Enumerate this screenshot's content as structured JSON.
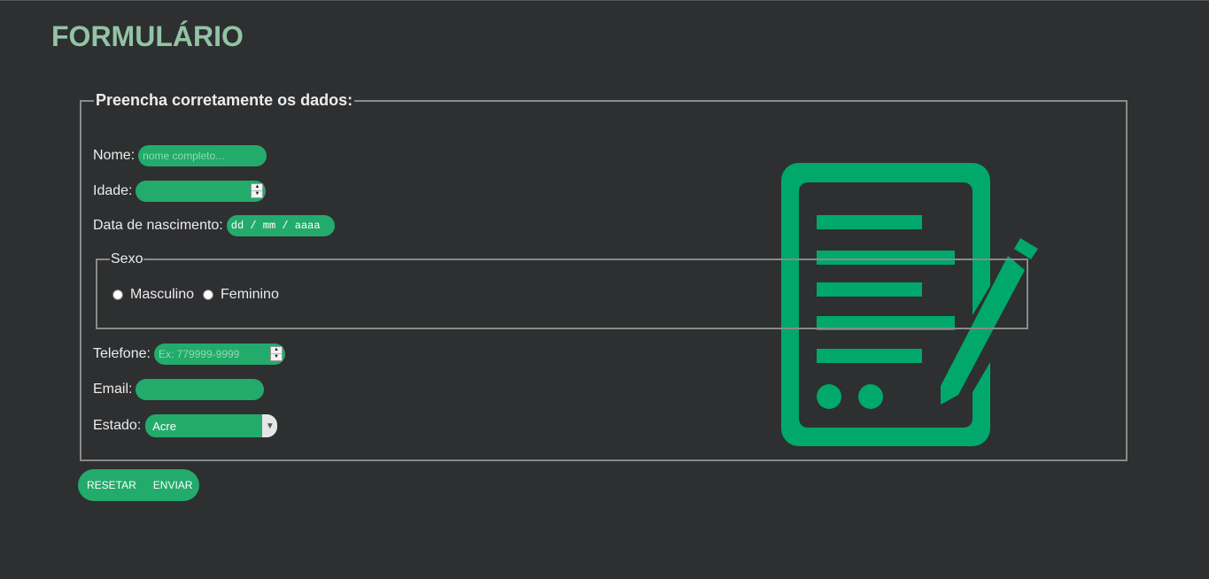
{
  "page": {
    "title": "FORMULÁRIO"
  },
  "form": {
    "legend": "Preencha corretamente os dados:",
    "fields": {
      "nome": {
        "label": "Nome:",
        "placeholder": "nome completo..."
      },
      "idade": {
        "label": "Idade:",
        "value": ""
      },
      "nascimento": {
        "label": "Data de nascimento:",
        "placeholder": "dd / mm / aaaa"
      },
      "telefone": {
        "label": "Telefone:",
        "placeholder": "Ex: 779999-9999"
      },
      "email": {
        "label": "Email:",
        "value": ""
      },
      "estado": {
        "label": "Estado:",
        "selected": "Acre"
      }
    },
    "sexo": {
      "legend": "Sexo",
      "options": [
        "Masculino",
        "Feminino"
      ]
    },
    "buttons": {
      "reset": "RESETAR",
      "submit": "ENVIAR"
    }
  },
  "icons": {
    "illustration": "document-edit-icon",
    "spin": "spin-button-icon",
    "dropdown": "chevron-down-icon"
  },
  "colors": {
    "background": "#2e2f31",
    "accent": "#22ab6b",
    "title": "#92c4a4",
    "border": "#8a8a8a",
    "illustration": "#00a86b"
  }
}
